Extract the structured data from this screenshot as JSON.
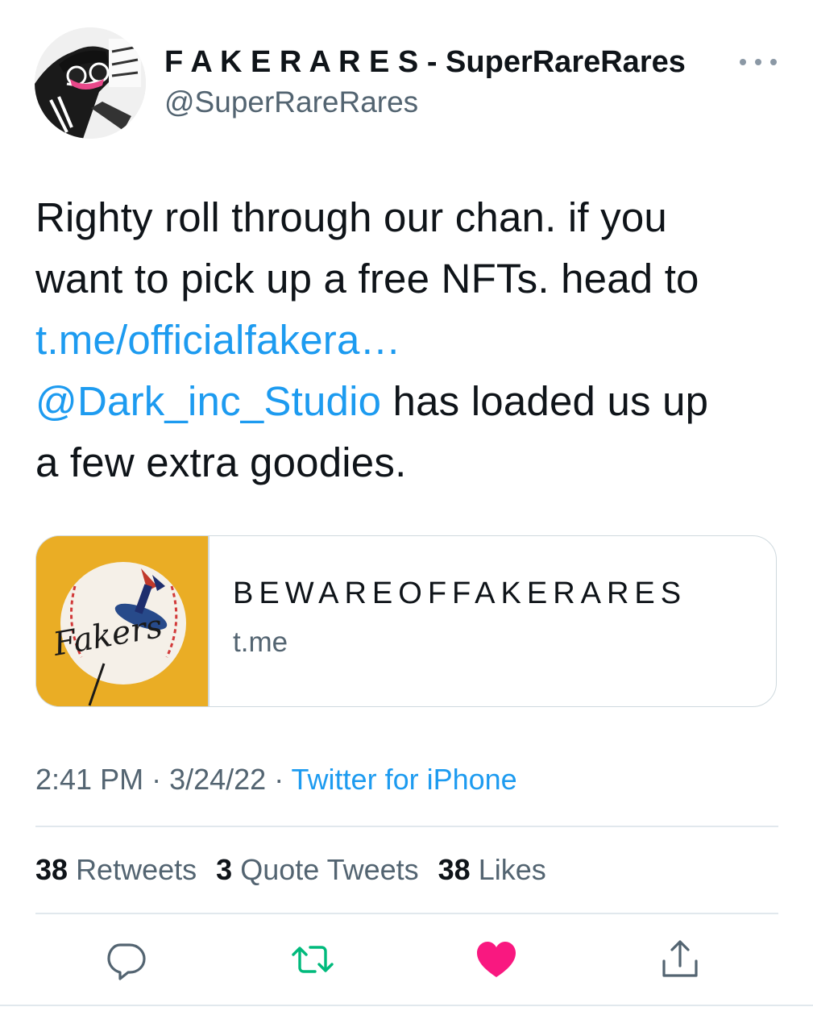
{
  "author": {
    "display_name": "F A K E R A R E S - SuperRareRares",
    "handle": "@SuperRareRares",
    "avatar_icon": "avatar-illustration"
  },
  "tweet": {
    "line1": "Righty roll through our chan. if you",
    "line2": "want to pick up a free NFTs. head to",
    "link_url": "t.me/officialfakera…",
    "mention": "@Dark_inc_Studio",
    "line4_rest": " has loaded us up",
    "line5": "a few extra goodies."
  },
  "card": {
    "title": "BEWAREOFFAKERARES",
    "domain": "t.me",
    "thumb_text": "Fakers"
  },
  "meta": {
    "time": "2:41 PM",
    "sep1": " · ",
    "date": "3/24/22",
    "sep2": " · ",
    "source": "Twitter for iPhone"
  },
  "stats": {
    "retweets_count": "38",
    "retweets_label": "Retweets",
    "quotes_count": "3",
    "quotes_label": "Quote Tweets",
    "likes_count": "38",
    "likes_label": "Likes"
  },
  "actions": [
    {
      "name": "reply",
      "icon": "reply-icon",
      "color": "#536471"
    },
    {
      "name": "retweet",
      "icon": "retweet-icon",
      "color": "#00ba7c"
    },
    {
      "name": "like",
      "icon": "heart-icon",
      "color": "#f91880"
    },
    {
      "name": "share",
      "icon": "share-icon",
      "color": "#536471"
    }
  ],
  "colors": {
    "link": "#1d9bf0",
    "text": "#0f1419",
    "muted": "#536471",
    "retweeted": "#00ba7c",
    "liked": "#f91880"
  }
}
